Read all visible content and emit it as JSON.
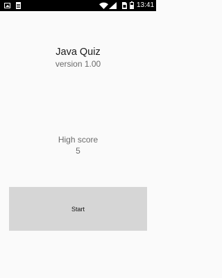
{
  "status_bar": {
    "time": "13:41",
    "icons": [
      "gallery-icon",
      "document-icon",
      "wifi-icon",
      "signal-icon",
      "sim-card-icon",
      "battery-icon"
    ]
  },
  "app": {
    "title": "Java Quiz",
    "version": "version 1.00"
  },
  "high_score": {
    "label": "High score",
    "value": "5"
  },
  "start_button": {
    "label": "Start"
  },
  "colors": {
    "background": "#fafafa",
    "status_bar": "#000000",
    "button": "#d6d6d6",
    "title_text": "#1a1a1a",
    "secondary_text": "#6b6b6b"
  }
}
